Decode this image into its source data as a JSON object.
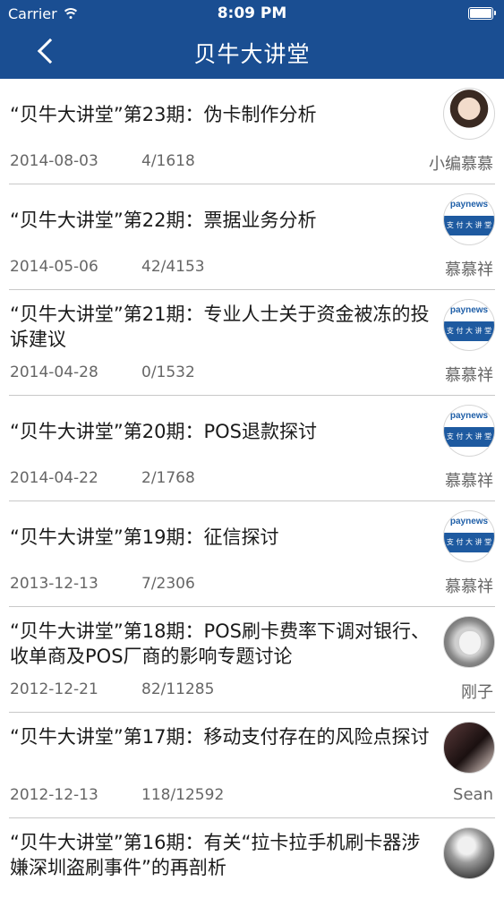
{
  "status_bar": {
    "carrier": "Carrier",
    "time": "8:09 PM"
  },
  "nav": {
    "title": "贝牛大讲堂"
  },
  "items": [
    {
      "title": "“贝牛大讲堂”第23期：伪卡制作分析",
      "date": "2014-08-03",
      "count": "4/1618",
      "author": "小编慕慕",
      "avatar": "woman-avatar"
    },
    {
      "title": "“贝牛大讲堂”第22期：票据业务分析",
      "date": "2014-05-06",
      "count": "42/4153",
      "author": "慕慕祥",
      "avatar": "paynews-avatar"
    },
    {
      "title": "“贝牛大讲堂”第21期：专业人士关于资金被冻的投诉建议",
      "date": "2014-04-28",
      "count": "0/1532",
      "author": "慕慕祥",
      "avatar": "paynews-avatar"
    },
    {
      "title": "“贝牛大讲堂”第20期：POS退款探讨",
      "date": "2014-04-22",
      "count": "2/1768",
      "author": "慕慕祥",
      "avatar": "paynews-avatar"
    },
    {
      "title": "“贝牛大讲堂”第19期：征信探讨",
      "date": "2013-12-13",
      "count": "7/2306",
      "author": "慕慕祥",
      "avatar": "paynews-avatar"
    },
    {
      "title": "“贝牛大讲堂”第18期：POS刷卡费率下调对银行、收单商及POS厂商的影响专题讨论",
      "date": "2012-12-21",
      "count": "82/11285",
      "author": "刚子",
      "avatar": "apple-avatar"
    },
    {
      "title": "“贝牛大讲堂”第17期：移动支付存在的风险点探讨",
      "date": "2012-12-13",
      "count": "118/12592",
      "author": "Sean",
      "avatar": "dark-avatar"
    },
    {
      "title": "“贝牛大讲堂”第16期：有关“拉卡拉手机刷卡器涉嫌深圳盗刷事件”的再剖析",
      "date": "",
      "count": "",
      "author": "",
      "avatar": "robot-avatar"
    }
  ],
  "paynews_logo": {
    "top": "paynews",
    "bottom": "支 付 大 讲 堂"
  },
  "colors": {
    "header": "#1a4e92",
    "separator": "#c8c8c8",
    "meta_text": "#666666"
  }
}
